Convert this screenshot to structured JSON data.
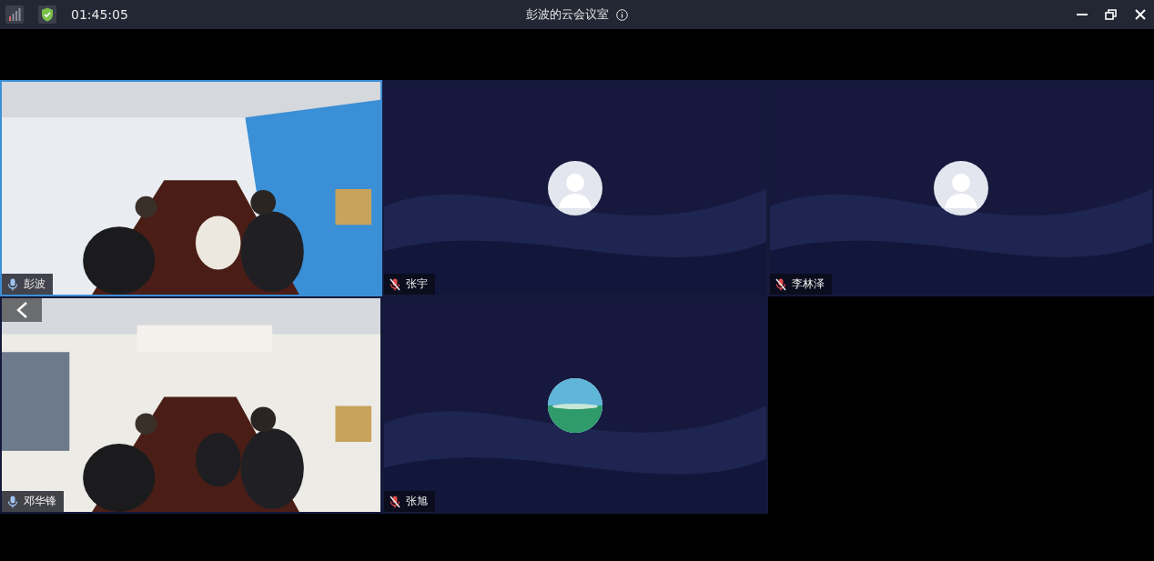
{
  "title_bar": {
    "time": "01:45:05",
    "title": "彭波的云会议室"
  },
  "tiles": [
    {
      "name": "彭波",
      "kind": "video",
      "muted": false,
      "selected": true
    },
    {
      "name": "张宇",
      "kind": "avatar",
      "muted": true,
      "selected": false
    },
    {
      "name": "李林泽",
      "kind": "avatar",
      "muted": true,
      "selected": false
    },
    {
      "name": "邓华锋",
      "kind": "video",
      "muted": false,
      "selected": false
    },
    {
      "name": "张旭",
      "kind": "photo-avatar",
      "muted": true,
      "selected": false
    }
  ]
}
